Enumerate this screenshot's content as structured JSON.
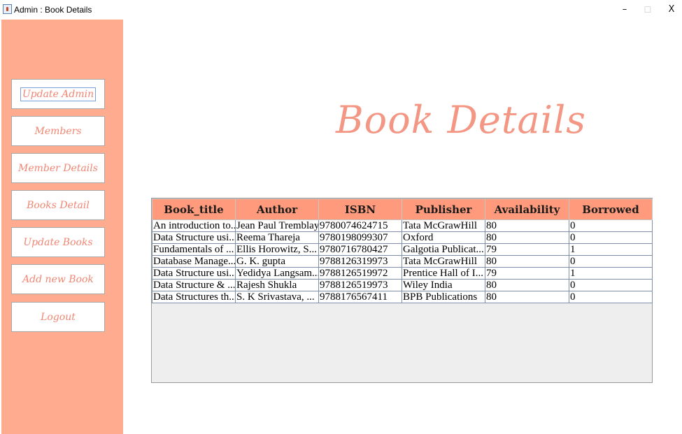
{
  "window": {
    "title": "Admin : Book Details",
    "minimize": "–",
    "maximize": "☐",
    "close": "X"
  },
  "sidebar": {
    "buttons": [
      {
        "label": "Update Admin"
      },
      {
        "label": "Members"
      },
      {
        "label": "Member Details"
      },
      {
        "label": "Books Detail"
      },
      {
        "label": "Update Books"
      },
      {
        "label": "Add new Book"
      },
      {
        "label": "Logout"
      }
    ]
  },
  "main": {
    "title": "Book Details"
  },
  "table": {
    "headers": [
      "Book_title",
      "Author",
      "ISBN",
      "Publisher",
      "Availability",
      "Borrowed"
    ],
    "rows": [
      [
        "An introduction to...",
        "Jean Paul Tremblay",
        "9780074624715",
        "Tata McGrawHill",
        "80",
        "0"
      ],
      [
        "Data Structure usi...",
        "Reema Thareja",
        "9780198099307",
        "Oxford",
        "80",
        "0"
      ],
      [
        "Fundamentals of ...",
        "Ellis Horowitz, S...",
        "9780716780427",
        "Galgotia Publicat...",
        "79",
        "1"
      ],
      [
        "Database Manage...",
        "G. K. gupta",
        "9788126319973",
        "Tata McGrawHill",
        "80",
        "0"
      ],
      [
        "Data Structure usi...",
        "Yedidya Langsam...",
        "9788126519972",
        "Prentice Hall of I...",
        "79",
        "1"
      ],
      [
        "Data Structure & ...",
        "Rajesh Shukla",
        "9788126519973",
        "Wiley India",
        "80",
        "0"
      ],
      [
        "Data Structures th...",
        "S. K Srivastava, ...",
        "9788176567411",
        "BPB Publications",
        "80",
        "0"
      ]
    ]
  }
}
